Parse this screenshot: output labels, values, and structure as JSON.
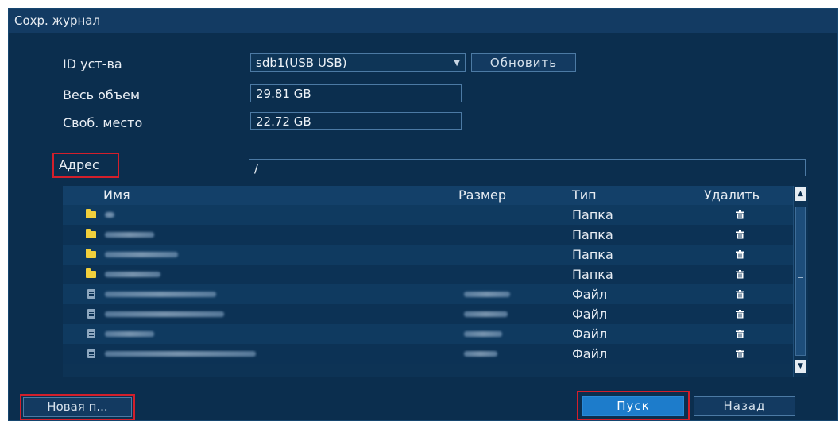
{
  "window": {
    "title": "Сохр. журнал"
  },
  "form": {
    "device_label": "ID уст-ва",
    "device_value": "sdb1(USB USB)",
    "refresh_label": "Обновить",
    "total_label": "Весь объем",
    "total_value": "29.81 GB",
    "free_label": "Своб. место",
    "free_value": "22.72 GB",
    "address_label": "Адрес",
    "address_value": "/"
  },
  "table": {
    "columns": [
      "Имя",
      "Размер",
      "Тип",
      "Удалить"
    ],
    "rows": [
      {
        "icon": "folder-icon",
        "type": "Папка"
      },
      {
        "icon": "folder-icon",
        "type": "Папка"
      },
      {
        "icon": "folder-icon",
        "type": "Папка"
      },
      {
        "icon": "folder-icon",
        "type": "Папка"
      },
      {
        "icon": "file-icon",
        "type": "Файл"
      },
      {
        "icon": "file-icon",
        "type": "Файл"
      },
      {
        "icon": "file-icon",
        "type": "Файл"
      },
      {
        "icon": "file-icon",
        "type": "Файл"
      }
    ]
  },
  "buttons": {
    "new_folder": "Новая п...",
    "start": "Пуск",
    "back": "Назад"
  },
  "colors": {
    "dialog_bg": "#0b2e4e",
    "accent_button": "#1d7ccb",
    "highlight_box": "#d31f2b",
    "folder": "#f1cf3c"
  }
}
